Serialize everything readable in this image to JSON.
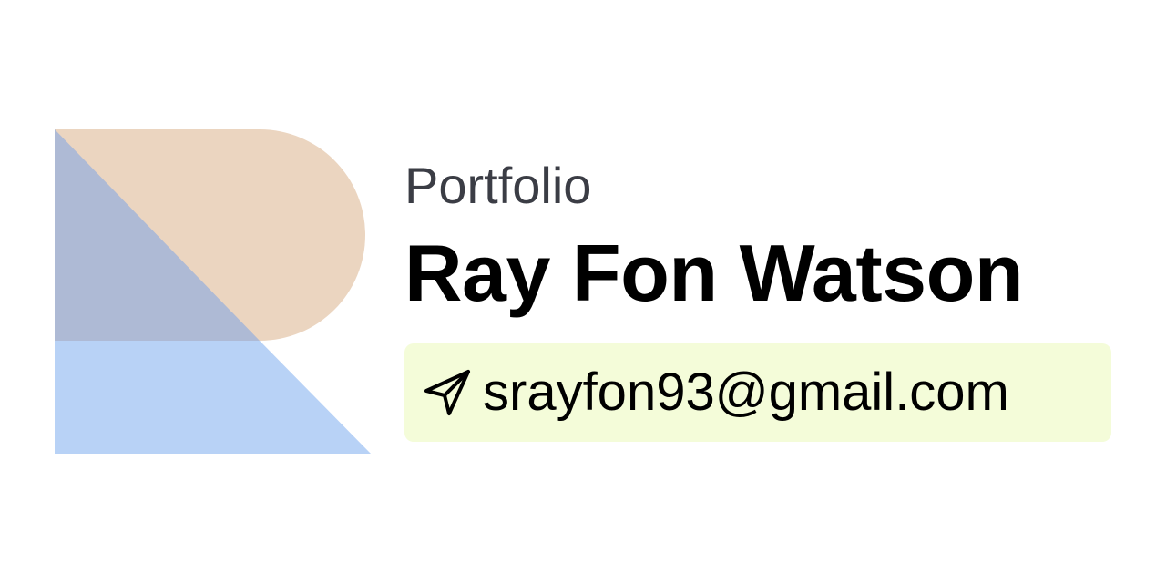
{
  "header": {
    "subtitle": "Portfolio",
    "name": "Ray Fon Watson"
  },
  "contact": {
    "email": "srayfon93@gmail.com",
    "icon": "send-icon"
  },
  "logo": {
    "icon": "r-monogram-logo",
    "colors": {
      "peach": "#ebd5c0",
      "slate_blue": "#aebad5",
      "light_blue": "#b8d2f6"
    }
  },
  "colors": {
    "background": "#ffffff",
    "contact_bg": "#f4fcd9",
    "subtitle_text": "#3b3d45",
    "name_text": "#000000"
  }
}
